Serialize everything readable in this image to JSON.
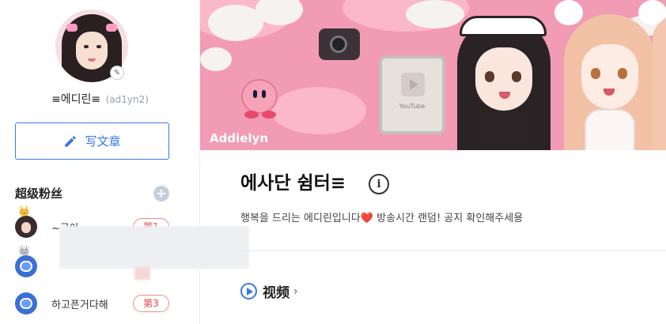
{
  "profile": {
    "display_name": "≡에디린≡",
    "handle": "(ad1yn2)"
  },
  "sidebar": {
    "write_label": "写文章",
    "fans_title": "超级粉丝",
    "fans_add": "+",
    "fans": [
      {
        "name": "~구아~",
        "rank": "第1"
      },
      {
        "name": "",
        "rank": ""
      },
      {
        "name": "하고픈거다해",
        "rank": "第3"
      }
    ]
  },
  "banner": {
    "name": "Addielyn",
    "plaque_text": "YouTube"
  },
  "channel": {
    "title": "에사단 쉼터≡",
    "info_symbol": "i",
    "description": "행복을 드리는 에디린입니다❤️ 방송시간 랜덤! 공지 확인해주세용"
  },
  "sections": {
    "video_label": "视频",
    "video_chevron": "›"
  },
  "colors": {
    "accent": "#3a78e8",
    "banner_pink": "#f29bb5",
    "rank_red": "#e44444"
  }
}
